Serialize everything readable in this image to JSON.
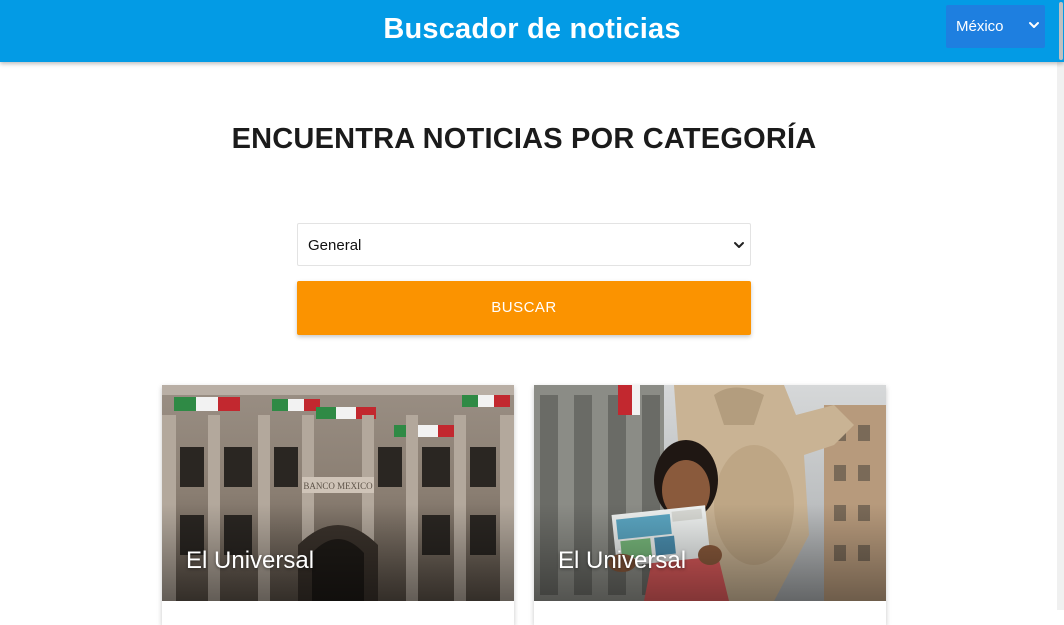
{
  "navbar": {
    "title": "Buscador de noticias",
    "country": {
      "selected": "México",
      "icon": "chevron-down-icon"
    }
  },
  "main": {
    "heading": "ENCUENTRA NOTICIAS POR CATEGORÍA",
    "category": {
      "selected": "General",
      "icon": "chevron-down-icon"
    },
    "search_button_label": "BUSCAR"
  },
  "news": [
    {
      "source": "El Universal",
      "image": "bank-building-photo"
    },
    {
      "source": "El Universal",
      "image": "lottery-ticket-woman-photo"
    }
  ],
  "colors": {
    "navbar": "#039be5",
    "country_select": "#1e7fe0",
    "search_button": "#fb9300",
    "heading": "#1b1b1b"
  }
}
